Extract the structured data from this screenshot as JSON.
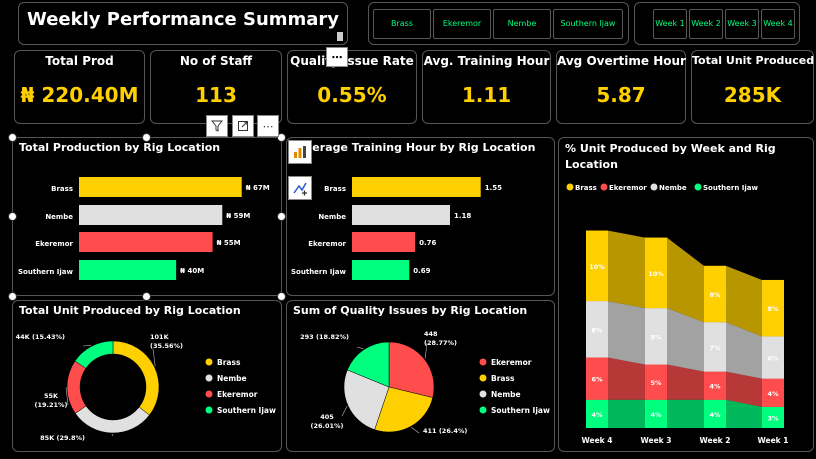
{
  "header": {
    "title": "Weekly Performance Summary"
  },
  "slicers": {
    "rigs": [
      "Brass",
      "Ekeremor",
      "Nembe",
      "Southern Ijaw"
    ],
    "weeks": [
      "Week 1",
      "Week 2",
      "Week 3",
      "Week 4"
    ]
  },
  "kpis": [
    {
      "label": "Total Prod",
      "value": "₦ 220.40M"
    },
    {
      "label": "No of Staff",
      "value": "113"
    },
    {
      "label": "Quality Issue Rate",
      "value": "0.55%"
    },
    {
      "label": "Avg. Training Hour",
      "value": "1.11"
    },
    {
      "label": "Avg Overtime Hour",
      "value": "5.87"
    },
    {
      "label": "Total Unit Produced",
      "value": "285K"
    }
  ],
  "colors": {
    "brass": "#ffd000",
    "nembe": "#e0e0e0",
    "ekeremor": "#ff4d4d",
    "southern_ijaw": "#00ff7f",
    "accent": "#ffd000"
  },
  "chart_data": [
    {
      "type": "bar",
      "title": "Total Production by Rig Location",
      "categories": [
        "Brass",
        "Nembe",
        "Ekeremor",
        "Southern Ijaw"
      ],
      "values": [
        67,
        59,
        55,
        40
      ],
      "labels": [
        "₦ 67M",
        "₦ 59M",
        "₦ 55M",
        "₦ 40M"
      ],
      "xlim": [
        0,
        70
      ]
    },
    {
      "type": "bar",
      "title": "Average Training Hour by Rig Location",
      "categories": [
        "Brass",
        "Nembe",
        "Ekeremor",
        "Southern Ijaw"
      ],
      "values": [
        1.55,
        1.18,
        0.76,
        0.69
      ],
      "labels": [
        "1.55",
        "1.18",
        "0.76",
        "0.69"
      ],
      "xlim": [
        0,
        1.65
      ]
    },
    {
      "type": "pie",
      "donut": true,
      "title": "Total Unit Produced by Rig Location",
      "slices": [
        {
          "name": "Brass",
          "value": 101,
          "label": "101K",
          "pct": "(35.56%)"
        },
        {
          "name": "Nembe",
          "value": 85,
          "label": "85K",
          "pct": "(29.8%)"
        },
        {
          "name": "Ekeremor",
          "value": 55,
          "label": "55K",
          "pct": "(19.21%)"
        },
        {
          "name": "Southern Ijaw",
          "value": 44,
          "label": "44K",
          "pct": "(15.43%)"
        }
      ],
      "legend": [
        "Brass",
        "Nembe",
        "Ekeremor",
        "Southern Ijaw"
      ]
    },
    {
      "type": "pie",
      "title": "Sum of Quality Issues by Rig Location",
      "slices": [
        {
          "name": "Ekeremor",
          "value": 448,
          "label": "448",
          "pct": "(28.77%)"
        },
        {
          "name": "Brass",
          "value": 411,
          "label": "411",
          "pct": "(26.4%)"
        },
        {
          "name": "Nembe",
          "value": 405,
          "label": "405",
          "pct": "(26.01%)"
        },
        {
          "name": "Southern Ijaw",
          "value": 293,
          "label": "293",
          "pct": "(18.82%)"
        }
      ],
      "legend": [
        "Ekeremor",
        "Brass",
        "Nembe",
        "Southern Ijaw"
      ]
    },
    {
      "type": "area",
      "title": "% Unit Produced by Week and Rig Location",
      "legend": [
        "Brass",
        "Ekeremor",
        "Nembe",
        "Southern Ijaw"
      ],
      "x": [
        "Week 4",
        "Week 3",
        "Week 2",
        "Week 1"
      ],
      "series": [
        {
          "name": "Southern Ijaw",
          "values": [
            4,
            4,
            4,
            3
          ],
          "labels": [
            "4%",
            "4%",
            "4%",
            "3%"
          ]
        },
        {
          "name": "Ekeremor",
          "values": [
            6,
            5,
            4,
            4
          ],
          "labels": [
            "6%",
            "5%",
            "4%",
            "4%"
          ]
        },
        {
          "name": "Nembe",
          "values": [
            8,
            8,
            7,
            6
          ],
          "labels": [
            "8%",
            "8%",
            "7%",
            "6%"
          ]
        },
        {
          "name": "Brass",
          "values": [
            10,
            10,
            8,
            8
          ],
          "labels": [
            "10%",
            "10%",
            "8%",
            "8%"
          ]
        }
      ]
    }
  ]
}
